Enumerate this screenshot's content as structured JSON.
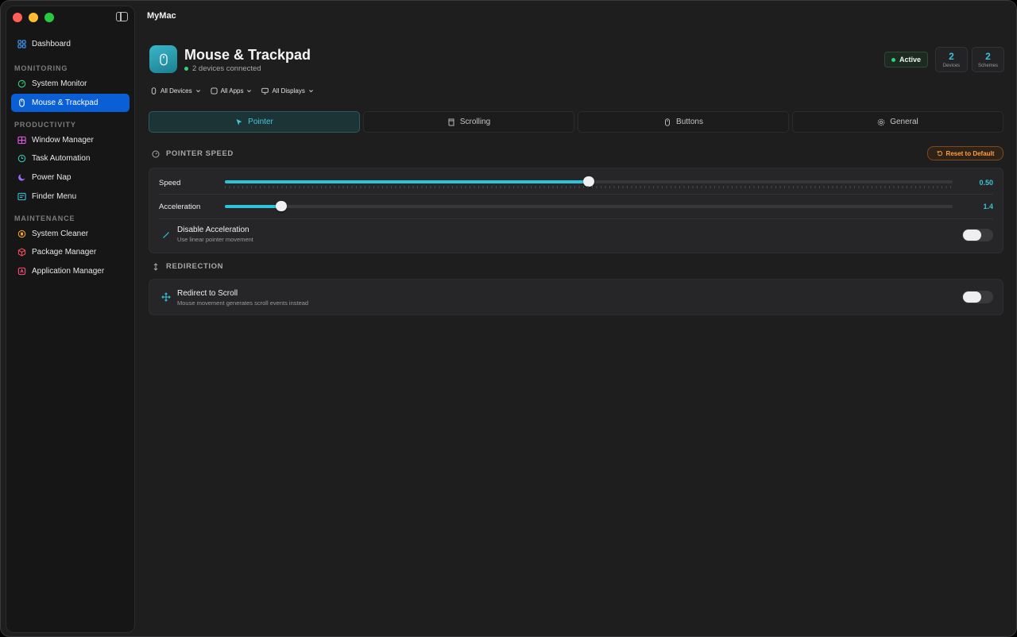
{
  "app": {
    "title": "MyMac"
  },
  "sidebar": {
    "top_items": [
      {
        "label": "Dashboard",
        "icon": "grid-icon",
        "color": "#3aa0ff"
      }
    ],
    "sections": [
      {
        "title": "MONITORING",
        "items": [
          {
            "label": "System Monitor",
            "icon": "gauge-icon",
            "color": "#33d17a"
          },
          {
            "label": "Mouse & Trackpad",
            "icon": "mouse-icon",
            "color": "#ffffff",
            "active": true
          }
        ]
      },
      {
        "title": "PRODUCTIVITY",
        "items": [
          {
            "label": "Window Manager",
            "icon": "window-grid-icon",
            "color": "#e85be8"
          },
          {
            "label": "Task Automation",
            "icon": "clock-icon",
            "color": "#2ec4a8"
          },
          {
            "label": "Power Nap",
            "icon": "moon-icon",
            "color": "#9c6bff"
          },
          {
            "label": "Finder Menu",
            "icon": "menu-icon",
            "color": "#35c4d8"
          }
        ]
      },
      {
        "title": "MAINTENANCE",
        "items": [
          {
            "label": "System Cleaner",
            "icon": "cleaner-icon",
            "color": "#f59e2e"
          },
          {
            "label": "Package Manager",
            "icon": "package-icon",
            "color": "#ff4d5e"
          },
          {
            "label": "Application Manager",
            "icon": "app-icon",
            "color": "#ff4d7a"
          }
        ]
      }
    ]
  },
  "header": {
    "title": "Mouse & Trackpad",
    "subtitle": "2 devices connected",
    "status": "Active",
    "stats": [
      {
        "value": "2",
        "label": "Devices"
      },
      {
        "value": "2",
        "label": "Schemes"
      }
    ]
  },
  "filters": [
    {
      "label": "All Devices",
      "icon": "mouse-small-icon"
    },
    {
      "label": "All Apps",
      "icon": "app-square-icon"
    },
    {
      "label": "All Displays",
      "icon": "display-icon"
    }
  ],
  "tabs": [
    {
      "label": "Pointer",
      "icon": "cursor-icon",
      "active": true
    },
    {
      "label": "Scrolling",
      "icon": "scroll-icon"
    },
    {
      "label": "Buttons",
      "icon": "mouse-icon"
    },
    {
      "label": "General",
      "icon": "gear-icon"
    }
  ],
  "pointer_speed": {
    "title": "POINTER SPEED",
    "reset_label": "Reset to Default",
    "speed": {
      "label": "Speed",
      "value": "0.50",
      "fraction": 0.5
    },
    "acceleration": {
      "label": "Acceleration",
      "value": "1.4",
      "fraction": 0.077
    },
    "disable_accel": {
      "title": "Disable Acceleration",
      "subtitle": "Use linear pointer movement",
      "enabled": false
    }
  },
  "redirection": {
    "title": "REDIRECTION",
    "redirect": {
      "title": "Redirect to Scroll",
      "subtitle": "Mouse movement generates scroll events instead",
      "enabled": false
    }
  },
  "colors": {
    "accent": "#2ec4d8",
    "sidebar_active": "#0a5fd4",
    "status_green": "#33d17a",
    "warning": "#ff9f43"
  }
}
